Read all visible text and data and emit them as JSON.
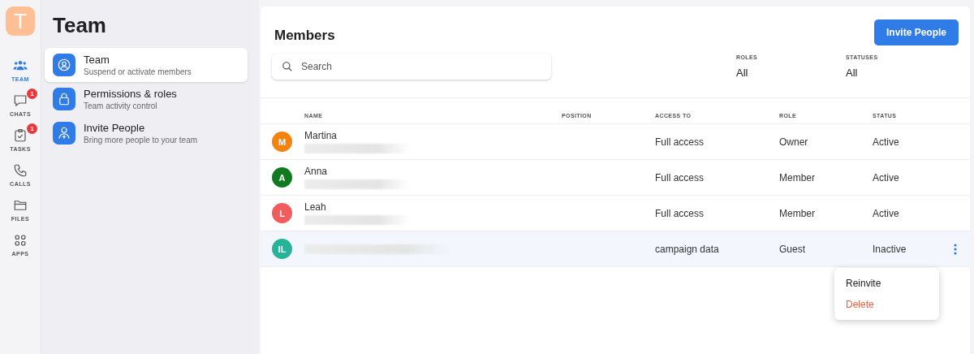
{
  "workspace": {
    "initial": "T"
  },
  "rail": [
    {
      "kind": "team",
      "label": "TEAM",
      "selected": true
    },
    {
      "kind": "chats",
      "label": "CHATS",
      "selected": false,
      "badge": "1"
    },
    {
      "kind": "tasks",
      "label": "TASKS",
      "selected": false,
      "badge": "1"
    },
    {
      "kind": "calls",
      "label": "CALLS",
      "selected": false
    },
    {
      "kind": "files",
      "label": "FILES",
      "selected": false
    },
    {
      "kind": "apps",
      "label": "APPS",
      "selected": false
    }
  ],
  "sidebar": {
    "title": "Team",
    "items": [
      {
        "kind": "team",
        "label": "Team",
        "description": "Suspend or activate members",
        "selected": true
      },
      {
        "kind": "lock",
        "label": "Permissions & roles",
        "description": "Team activity control",
        "selected": false
      },
      {
        "kind": "invite",
        "label": "Invite People",
        "description": "Bring more people to your team",
        "selected": false
      }
    ]
  },
  "members": {
    "title": "Members",
    "invite_button": "Invite People",
    "search": {
      "placeholder": "Search"
    },
    "filters": [
      {
        "label": "ROLES",
        "value": "All"
      },
      {
        "label": "STATUSES",
        "value": "All"
      }
    ],
    "columns": [
      "NAME",
      "POSITION",
      "ACCESS TO",
      "ROLE",
      "STATUS"
    ],
    "rows": [
      {
        "initials": "M",
        "color": "#f5820d",
        "name": "Martina",
        "access": "Full access",
        "role": "Owner",
        "status": "Active",
        "selected": false
      },
      {
        "initials": "A",
        "color": "#0f7a1f",
        "name": "Anna",
        "access": "Full access",
        "role": "Member",
        "status": "Active",
        "selected": false
      },
      {
        "initials": "L",
        "color": "#f25c5c",
        "name": "Leah",
        "access": "Full access",
        "role": "Member",
        "status": "Active",
        "selected": false
      },
      {
        "initials": "IL",
        "color": "#26b39a",
        "access": "campaign data",
        "role": "Guest",
        "status": "Inactive",
        "selected": true
      }
    ],
    "menu": [
      {
        "kind": "normal",
        "label": "Reinvite"
      },
      {
        "kind": "danger",
        "label": "Delete"
      }
    ]
  }
}
